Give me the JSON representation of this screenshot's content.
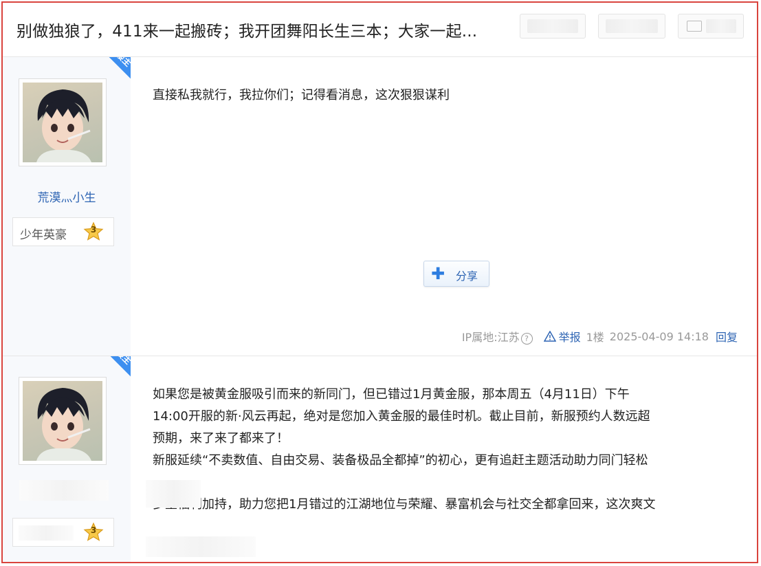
{
  "header": {
    "title": "别做独狼了，411来一起搬砖；我开团舞阳长生三本；大家一起..."
  },
  "posts": [
    {
      "badge": "楼主",
      "username": "荒漠灬小生",
      "level_title": "少年英豪",
      "level_num": "3",
      "content": [
        "直接私我就行，我拉你们；记得看消息，这次狠狠谋利"
      ],
      "share_label": "分享",
      "ip_label": "IP属地:江苏",
      "report_label": "举报",
      "floor": "1楼",
      "time": "2025-04-09 14:18",
      "reply_label": "回复"
    },
    {
      "badge": "楼主",
      "level_num": "3",
      "content": [
        "如果您是被黄金服吸引而来的新同门，但已错过1月黄金服，那本周五（4月11日）下午",
        "14:00开服的新·风云再起，绝对是您加入黄金服的最佳时机。截止目前，新服预约人数远超",
        "预期，来了来了都来了！",
        "新服延续“不卖数值、自由交易、装备极品全都掉”的初心，更有追赶主题活动助力同门轻松",
        "多重福利加持，助力您把1月错过的江湖地位与荣耀、暴富机会与社交全都拿回来，这次爽文"
      ]
    }
  ],
  "colors": {
    "frame_border": "#d9433d",
    "badge": "#3d8ff0",
    "link": "#2d64b3",
    "meta": "#999999"
  }
}
